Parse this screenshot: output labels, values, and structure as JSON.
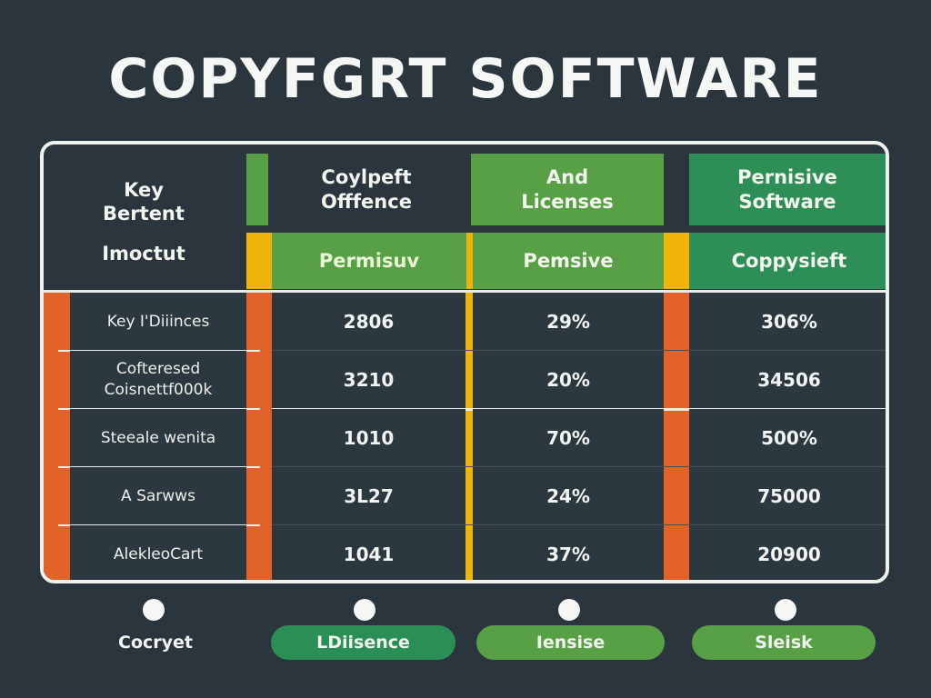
{
  "title": "COPYFGRT SOFTWARE",
  "colors": {
    "background": "#2a353d",
    "green_light": "#57a045",
    "green_dark": "#2e8f56",
    "yellow": "#f0b30a",
    "orange": "#e3622a",
    "border": "#eef1ec"
  },
  "table": {
    "corner_header": {
      "line1": "Key",
      "line2": "Bertent",
      "line3": "Imoctut"
    },
    "column_headers": [
      {
        "top_line1": "Coylpeft",
        "top_line2": "Offfence",
        "sub": "Permisuv"
      },
      {
        "top_line1": "And",
        "top_line2": "Licenses",
        "sub": "Pemsive"
      },
      {
        "top_line1": "Pernisive",
        "top_line2": "Software",
        "sub": "Coppysieft"
      }
    ],
    "rows": [
      {
        "label_line1": "Key I'Diiinces",
        "label_line2": "",
        "values": [
          "2806",
          "29%",
          "306%"
        ]
      },
      {
        "label_line1": "Cofteresed",
        "label_line2": "Coisnettf000k",
        "values": [
          "3210",
          "20%",
          "34506"
        ]
      },
      {
        "label_line1": "Steeale wenita",
        "label_line2": "",
        "values": [
          "1010",
          "70%",
          "500%"
        ]
      },
      {
        "label_line1": "A Sarwws",
        "label_line2": "",
        "values": [
          "3L27",
          "24%",
          "75000"
        ]
      },
      {
        "label_line1": "AlekleoCart",
        "label_line2": "",
        "values": [
          "1041",
          "37%",
          "20900"
        ]
      }
    ]
  },
  "legend": [
    {
      "label": "Cocryet",
      "style": "text"
    },
    {
      "label": "LDiisence",
      "style": "pill-dark-green"
    },
    {
      "label": "Iensise",
      "style": "pill-light-green"
    },
    {
      "label": "Sleisk",
      "style": "pill-light-green"
    }
  ]
}
